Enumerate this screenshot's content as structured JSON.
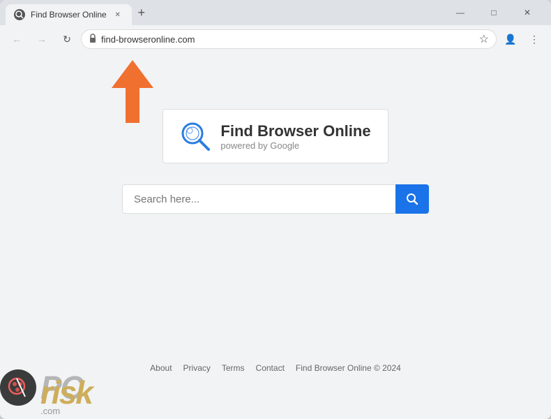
{
  "browser": {
    "tab_title": "Find Browser Online",
    "tab_favicon": "🔍",
    "new_tab_label": "+",
    "window_minimize": "—",
    "window_maximize": "□",
    "window_close": "✕",
    "address": "find-browseronline.com",
    "address_icon": "🔒",
    "back_btn": "←",
    "forward_btn": "→",
    "reload_btn": "↻",
    "star_icon": "☆",
    "profile_icon": "👤",
    "menu_icon": "⋮"
  },
  "page": {
    "logo_title": "Find Browser Online",
    "logo_subtitle": "powered by Google",
    "search_placeholder": "Search here...",
    "search_btn_icon": "🔍"
  },
  "footer": {
    "links": [
      "About",
      "Privacy",
      "Terms",
      "Contact"
    ],
    "copyright": "Find Browser Online © 2024"
  }
}
